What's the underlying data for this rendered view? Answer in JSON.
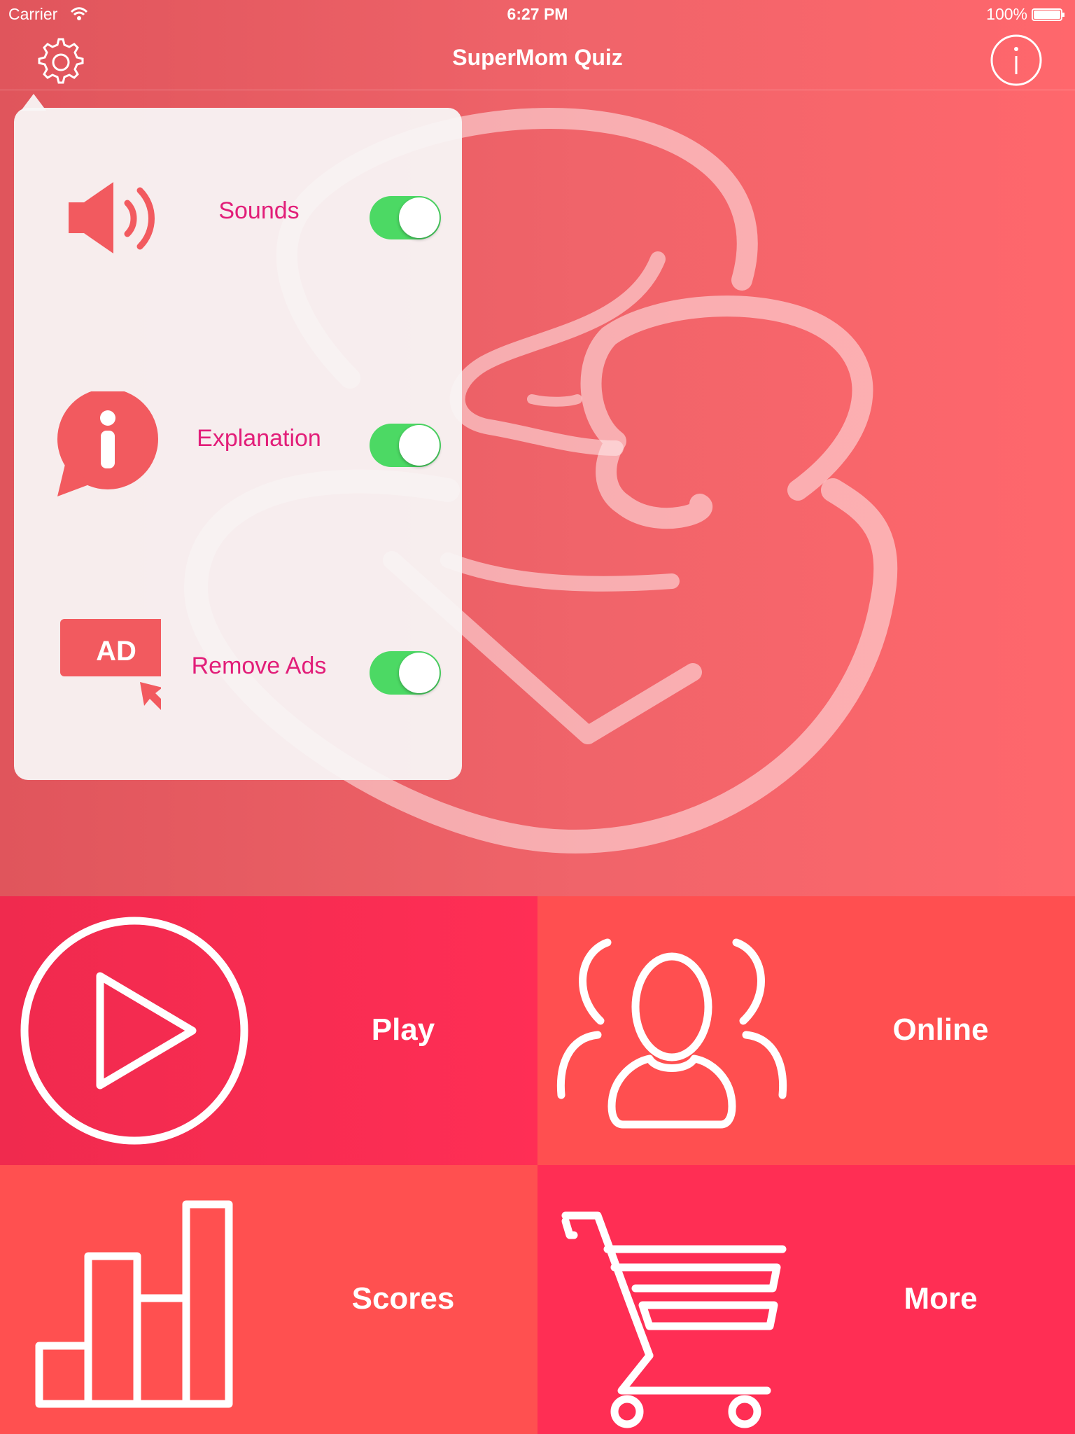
{
  "status_bar": {
    "carrier": "Carrier",
    "time": "6:27 PM",
    "battery": "100%"
  },
  "nav": {
    "title": "SuperMom Quiz",
    "left_icon": "gear-icon",
    "right_icon": "info-icon"
  },
  "settings": {
    "items": [
      {
        "label": "Sounds",
        "icon": "speaker-icon",
        "enabled": true
      },
      {
        "label": "Explanation",
        "icon": "info-bubble-icon",
        "enabled": true
      },
      {
        "label": "Remove Ads",
        "icon": "ad-icon",
        "enabled": true
      }
    ],
    "ad_badge": "AD"
  },
  "tiles": {
    "play": {
      "label": "Play",
      "icon": "play-icon"
    },
    "online": {
      "label": "Online",
      "icon": "users-icon"
    },
    "scores": {
      "label": "Scores",
      "icon": "bar-chart-icon"
    },
    "more": {
      "label": "More",
      "icon": "cart-icon"
    }
  },
  "colors": {
    "accent_text": "#e21e79",
    "toggle_on": "#4cd964",
    "icon_red": "#f25a5f"
  }
}
